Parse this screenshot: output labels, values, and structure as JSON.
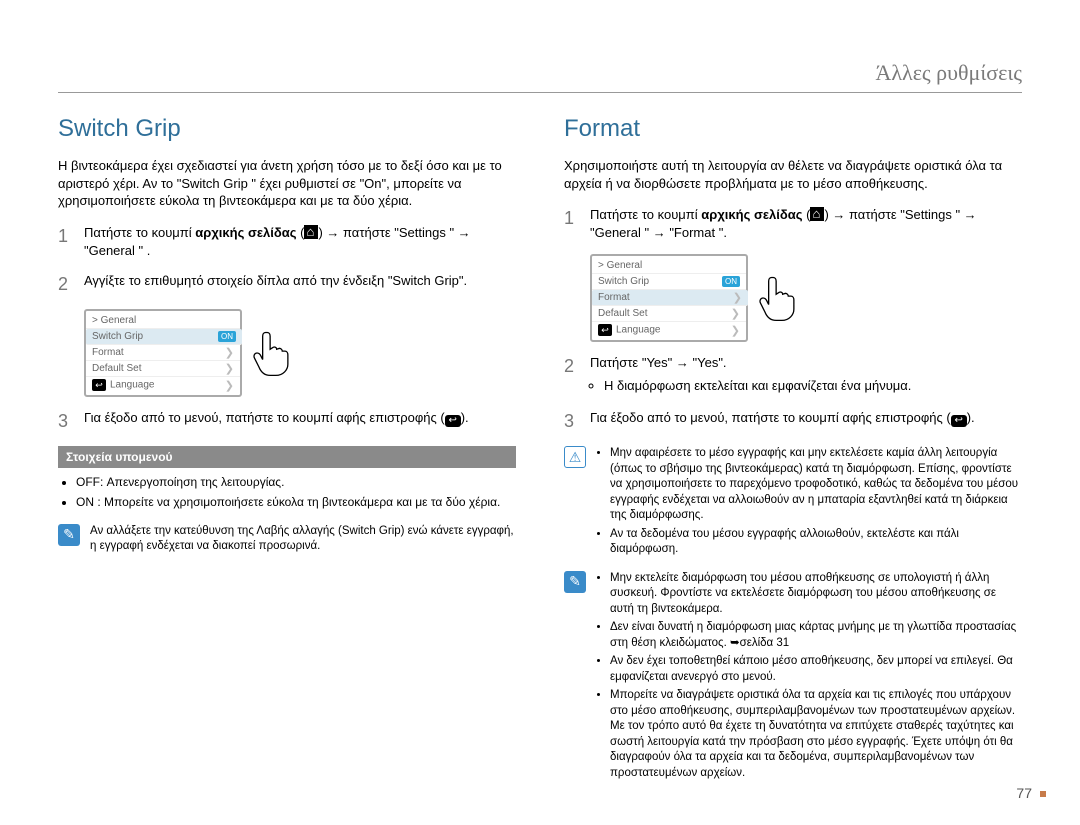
{
  "header": {
    "chapter": "Άλλες ρυθμίσεις"
  },
  "page_number": "77",
  "screen_menu": {
    "breadcrumb": "> General",
    "rows": [
      {
        "label": "Switch Grip",
        "badge": "ON"
      },
      {
        "label": "Format",
        "chev": "❯"
      },
      {
        "label": "Default Set",
        "chev": "❯"
      },
      {
        "label": "Language",
        "chev": "❯",
        "back": true
      }
    ]
  },
  "left": {
    "title": "Switch Grip",
    "intro": "Η βιντεοκάμερα έχει σχεδιαστεί για άνετη χρήση τόσο με το δεξί όσο και με το αριστερό χέρι. Αν το \"Switch Grip \" έχει ρυθμιστεί σε \"On\", μπορείτε να χρησιμοποιήσετε εύκολα τη βιντεοκάμερα και με τα δύο χέρια.",
    "steps": [
      {
        "n": "1",
        "body": "Πατήστε το κουμπί αρχικής σελίδας ( ⌂ ) → πατήστε \"Settings \" → \"General \" ."
      },
      {
        "n": "2",
        "body": "Αγγίξτε το επιθυμητό στοιχείο δίπλα από την ένδειξη \"Switch Grip\"."
      },
      {
        "n": "3",
        "body": "Για έξοδο από το μενού, πατήστε το κουμπί αφής επιστροφής ( ↩ )."
      }
    ],
    "submenu_heading": "Στοιχεία υπομενού",
    "submenu_items": [
      "OFF: Απενεργοποίηση της λειτουργίας.",
      "ΟΝ : Μπορείτε να χρησιμοποιήσετε εύκολα τη βιντεοκάμερα και με τα δύο χέρια."
    ],
    "note": "Αν αλλάξετε την κατεύθυνση της Λαβής αλλαγής (Switch Grip) ενώ κάνετε εγγραφή, η εγγραφή ενδέχεται να διακοπεί προσωρινά."
  },
  "right": {
    "title": "Format",
    "intro": "Χρησιμοποιήστε αυτή τη λειτουργία αν θέλετε να διαγράψετε οριστικά όλα τα αρχεία ή να διορθώσετε προβλήματα με το μέσο αποθήκευσης.",
    "steps": [
      {
        "n": "1",
        "body": "Πατήστε το κουμπί αρχικής σελίδας ( ⌂ ) → πατήστε \"Settings \" → \"General \" → \"Format \"."
      },
      {
        "n": "2",
        "body": "Πατήστε \"Yes\" → \"Yes\".",
        "sub": "Η διαμόρφωση εκτελείται και εμφανίζεται ένα μήνυμα."
      },
      {
        "n": "3",
        "body": "Για έξοδο από το μενού, πατήστε το κουμπί αφής επιστροφής ( ↩ )."
      }
    ],
    "warn_items": [
      "Μην αφαιρέσετε το μέσο εγγραφής και μην εκτελέσετε καμία άλλη λειτουργία (όπως το σβήσιμο της βιντεοκάμερας) κατά τη διαμόρφωση. Επίσης, φροντίστε να χρησιμοποιήσετε το παρεχόμενο τροφοδοτικό, καθώς τα δεδομένα του μέσου εγγραφής ενδέχεται να αλλοιωθούν αν η μπαταρία εξαντληθεί κατά τη διάρκεια της διαμόρφωσης.",
      "Αν τα δεδομένα του μέσου εγγραφής αλλοιωθούν, εκτελέστε και πάλι διαμόρφωση."
    ],
    "note_items": [
      "Μην εκτελείτε διαμόρφωση του μέσου αποθήκευσης σε υπολογιστή ή άλλη συσκευή. Φροντίστε να εκτελέσετε διαμόρφωση του μέσου αποθήκευσης σε αυτή τη βιντεοκάμερα.",
      "Δεν είναι δυνατή η διαμόρφωση μιας κάρτας μνήμης με τη γλωττίδα προστασίας στη θέση κλειδώματος. ➥σελίδα 31",
      "Αν δεν έχει τοποθετηθεί κάποιο μέσο αποθήκευσης, δεν μπορεί να επιλεγεί. Θα εμφανίζεται ανενεργό στο μενού.",
      "Μπορείτε να διαγράψετε οριστικά όλα τα αρχεία και τις επιλογές που υπάρχουν στο μέσο αποθήκευσης, συμπεριλαμβανομένων των προστατευμένων αρχείων. Με τον τρόπο αυτό θα έχετε τη δυνατότητα να επιτύχετε σταθερές ταχύτητες και σωστή λειτουργία κατά την πρόσβαση στο μέσο εγγραφής. Έχετε υπόψη ότι θα διαγραφούν όλα τα αρχεία και τα δεδομένα, συμπεριλαμβανομένων των προστατευμένων αρχείων."
    ]
  }
}
